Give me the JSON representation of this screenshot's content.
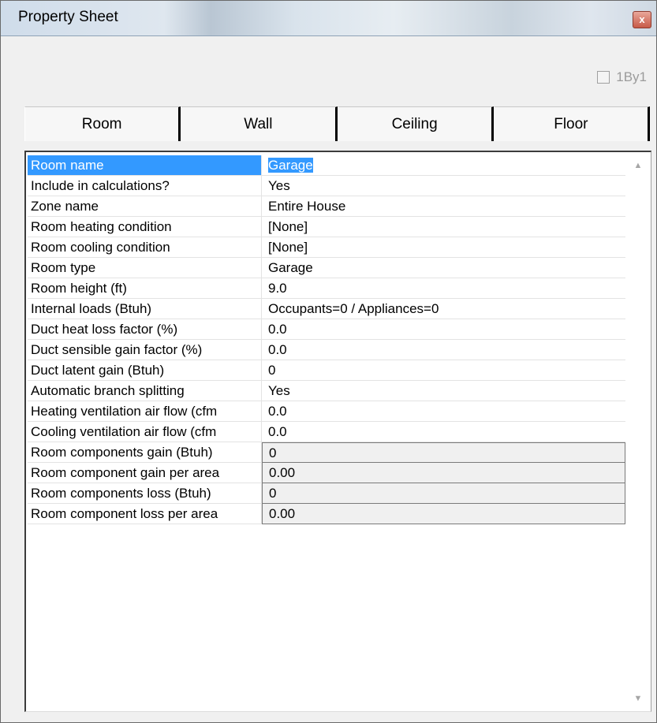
{
  "window": {
    "title": "Property Sheet",
    "close_glyph": "x"
  },
  "option": {
    "label": "1By1",
    "checked": false
  },
  "tabs": [
    {
      "label": "Room"
    },
    {
      "label": "Wall"
    },
    {
      "label": "Ceiling"
    },
    {
      "label": "Floor"
    }
  ],
  "properties": [
    {
      "label": "Room name",
      "value": "Garage"
    },
    {
      "label": "Include in calculations?",
      "value": "Yes"
    },
    {
      "label": "Zone name",
      "value": "Entire House"
    },
    {
      "label": "Room heating condition",
      "value": "[None]"
    },
    {
      "label": "Room cooling condition",
      "value": "[None]"
    },
    {
      "label": "Room type",
      "value": "Garage"
    },
    {
      "label": "Room height (ft)",
      "value": "9.0"
    },
    {
      "label": "Internal loads (Btuh)",
      "value": "Occupants=0 / Appliances=0"
    },
    {
      "label": "Duct heat loss factor (%)",
      "value": "0.0"
    },
    {
      "label": "Duct sensible gain factor (%)",
      "value": "0.0"
    },
    {
      "label": "Duct latent gain (Btuh)",
      "value": "0"
    },
    {
      "label": "Automatic branch splitting",
      "value": "Yes"
    },
    {
      "label": "Heating ventilation air flow (cfm",
      "value": "0.0"
    },
    {
      "label": "Cooling ventilation air flow (cfm",
      "value": "0.0"
    },
    {
      "label": "Room components gain (Btuh)",
      "value": "0"
    },
    {
      "label": "Room component gain per area",
      "value": "0.00"
    },
    {
      "label": "Room components loss (Btuh)",
      "value": "0"
    },
    {
      "label": "Room component loss per area",
      "value": "0.00"
    }
  ],
  "scrollbar": {
    "up_icon": "scroll-up-arrow",
    "down_icon": "scroll-down-arrow"
  }
}
